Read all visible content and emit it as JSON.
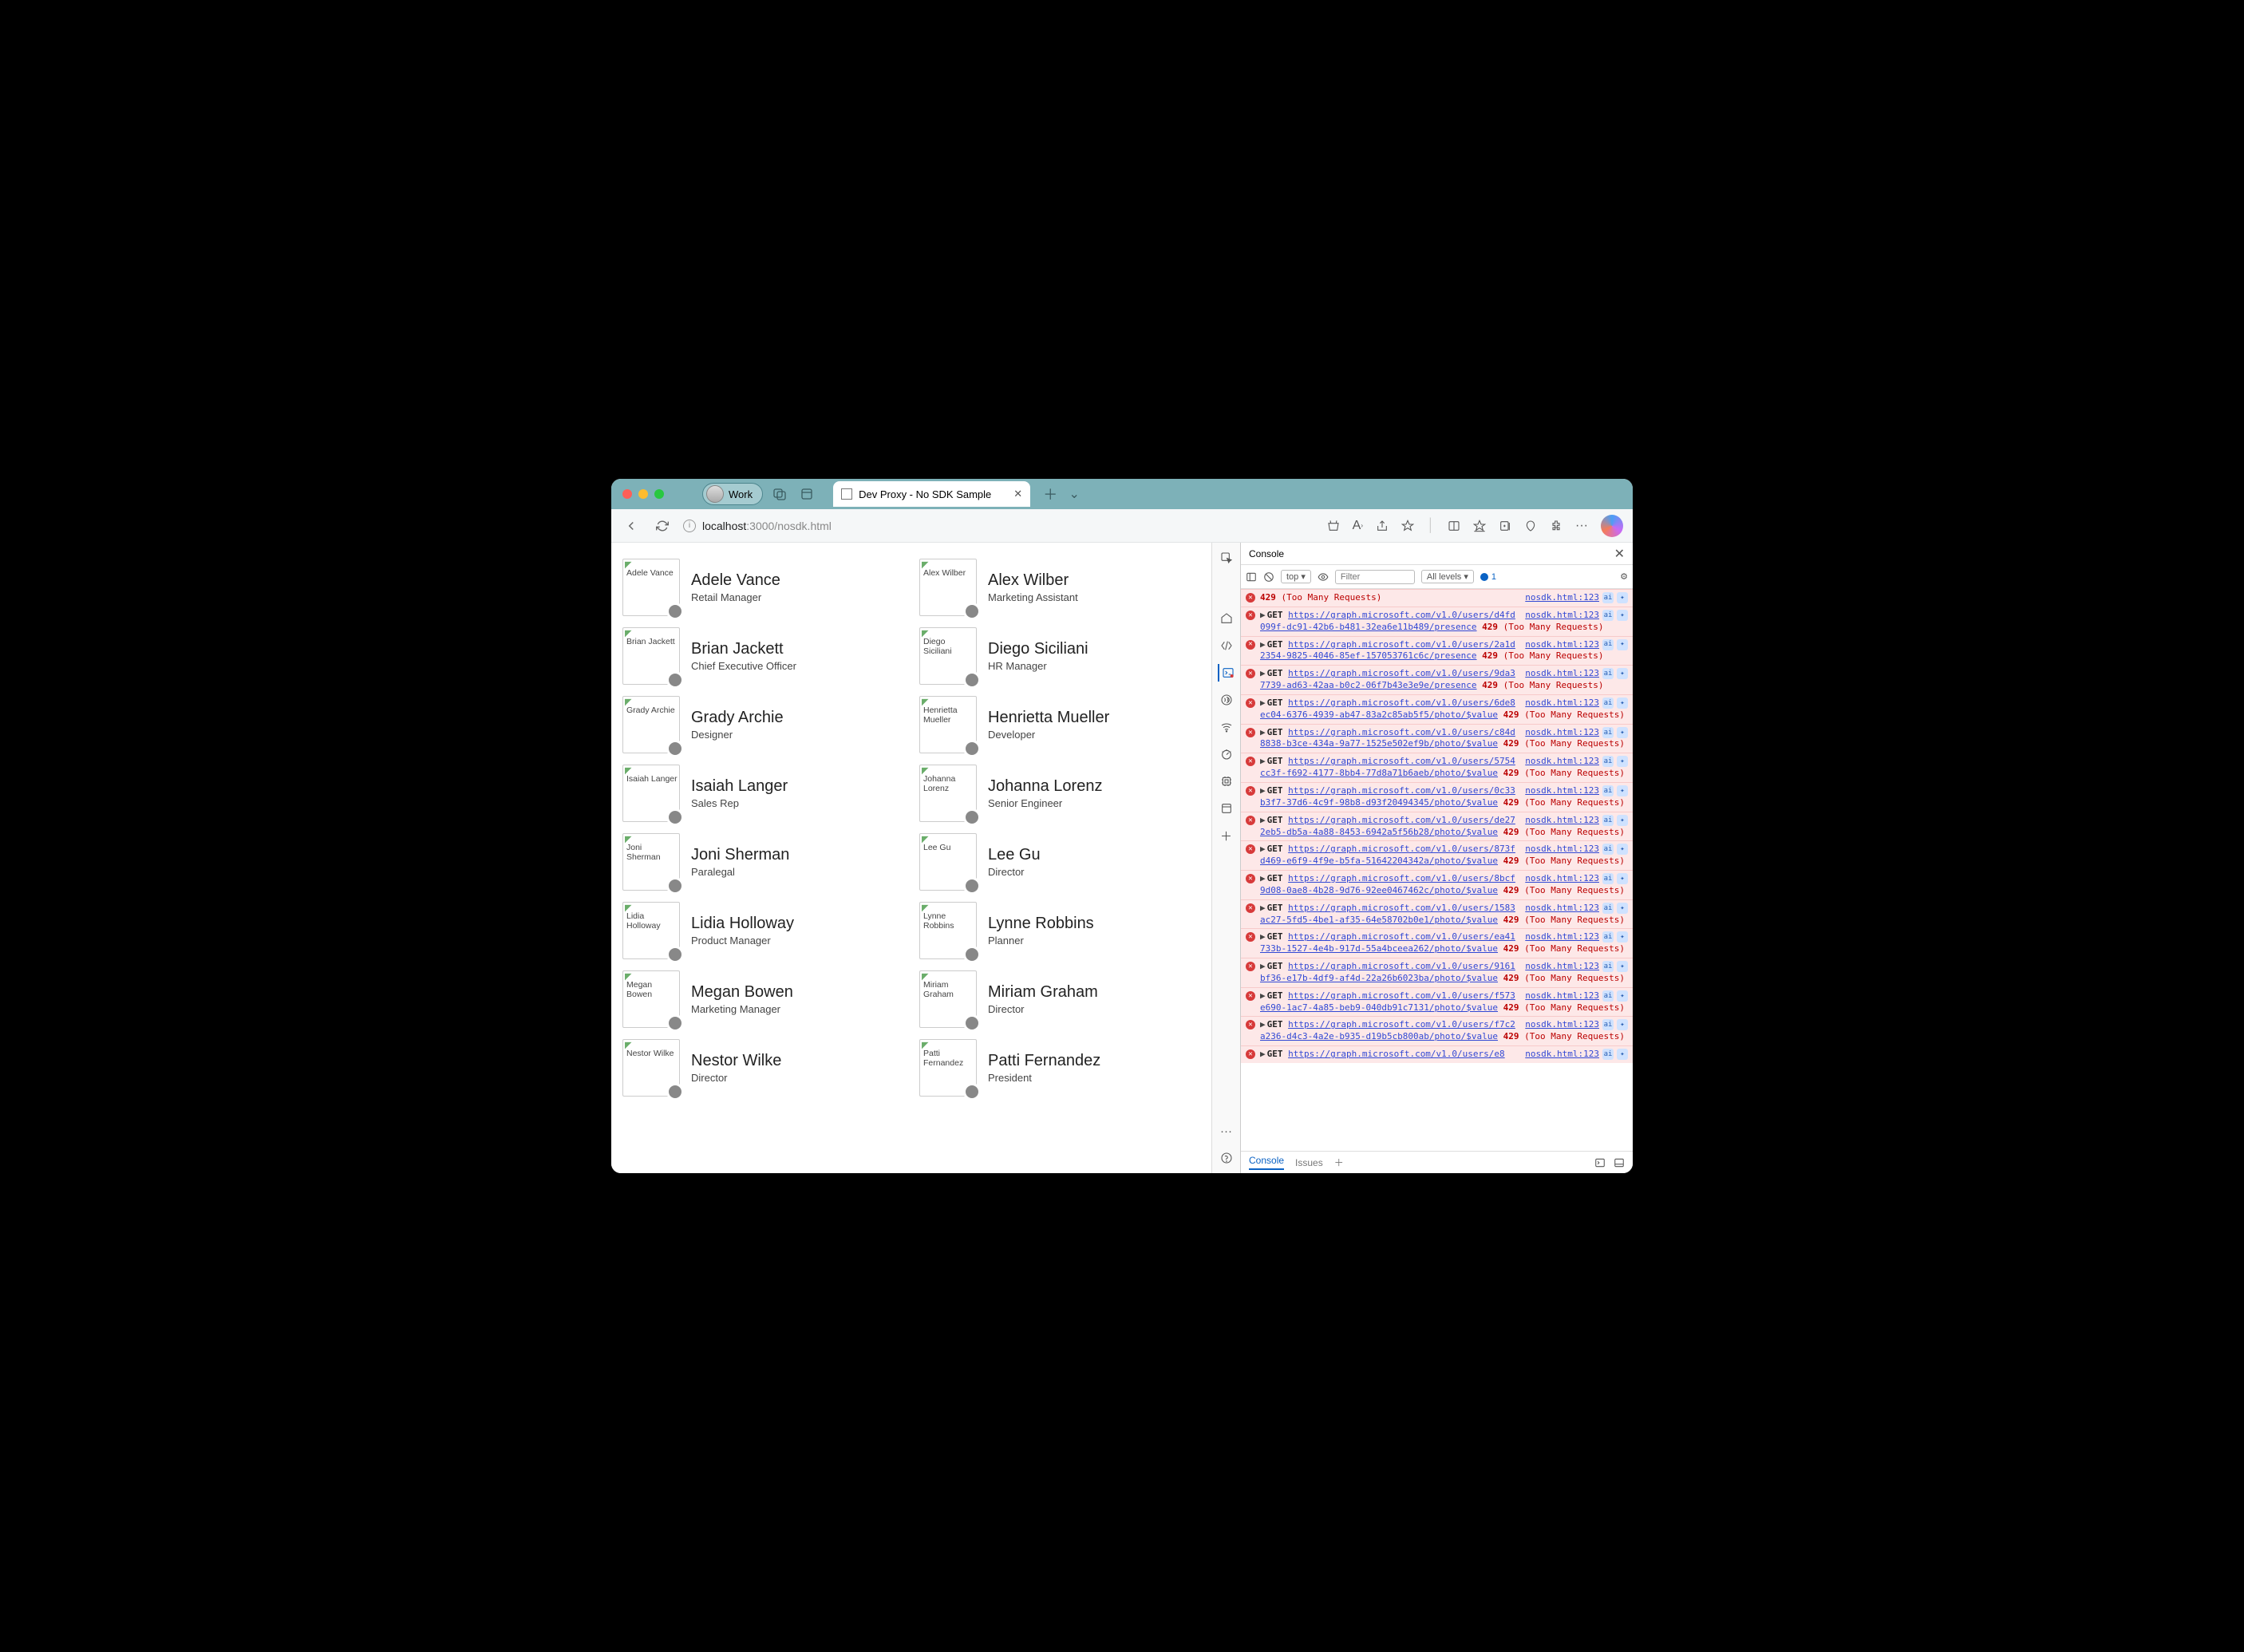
{
  "profile": {
    "label": "Work"
  },
  "tab": {
    "title": "Dev Proxy - No SDK Sample"
  },
  "url": {
    "info_icon": "i",
    "host": "localhost",
    "rest": ":3000/nosdk.html"
  },
  "people": [
    {
      "name": "Adele Vance",
      "title": "Retail Manager",
      "alt": "Adele Vance"
    },
    {
      "name": "Alex Wilber",
      "title": "Marketing Assistant",
      "alt": "Alex Wilber"
    },
    {
      "name": "Brian Jackett",
      "title": "Chief Executive Officer",
      "alt": "Brian Jackett"
    },
    {
      "name": "Diego Siciliani",
      "title": "HR Manager",
      "alt": "Diego Siciliani"
    },
    {
      "name": "Grady Archie",
      "title": "Designer",
      "alt": "Grady Archie"
    },
    {
      "name": "Henrietta Mueller",
      "title": "Developer",
      "alt": "Henrietta Mueller"
    },
    {
      "name": "Isaiah Langer",
      "title": "Sales Rep",
      "alt": "Isaiah Langer"
    },
    {
      "name": "Johanna Lorenz",
      "title": "Senior Engineer",
      "alt": "Johanna Lorenz"
    },
    {
      "name": "Joni Sherman",
      "title": "Paralegal",
      "alt": "Joni Sherman"
    },
    {
      "name": "Lee Gu",
      "title": "Director",
      "alt": "Lee Gu"
    },
    {
      "name": "Lidia Holloway",
      "title": "Product Manager",
      "alt": "Lidia Holloway"
    },
    {
      "name": "Lynne Robbins",
      "title": "Planner",
      "alt": "Lynne Robbins"
    },
    {
      "name": "Megan Bowen",
      "title": "Marketing Manager",
      "alt": "Megan Bowen"
    },
    {
      "name": "Miriam Graham",
      "title": "Director",
      "alt": "Miriam Graham"
    },
    {
      "name": "Nestor Wilke",
      "title": "Director",
      "alt": "Nestor Wilke"
    },
    {
      "name": "Patti Fernandez",
      "title": "President",
      "alt": "Patti Fernandez"
    }
  ],
  "devtools": {
    "title": "Console",
    "toolbar": {
      "context": "top",
      "filter_placeholder": "Filter",
      "levels": "All levels",
      "issue_count": "1"
    },
    "footer": {
      "console": "Console",
      "issues": "Issues"
    },
    "logs": [
      {
        "partial_top": true,
        "status": "429",
        "msg": "(Too Many Requests)",
        "src": "nosdk.html:123"
      },
      {
        "method": "GET",
        "url": "https://graph.microsoft.com/v1.0/users/d4fd099f-dc91-42b6-b481-32ea6e11b489/presence",
        "status": "429",
        "msg": "(Too Many Requests)",
        "src": "nosdk.html:123"
      },
      {
        "method": "GET",
        "url": "https://graph.microsoft.com/v1.0/users/2a1d2354-9825-4046-85ef-157053761c6c/presence",
        "status": "429",
        "msg": "(Too Many Requests)",
        "src": "nosdk.html:123"
      },
      {
        "method": "GET",
        "url": "https://graph.microsoft.com/v1.0/users/9da37739-ad63-42aa-b0c2-06f7b43e3e9e/presence",
        "status": "429",
        "msg": "(Too Many Requests)",
        "src": "nosdk.html:123"
      },
      {
        "method": "GET",
        "url": "https://graph.microsoft.com/v1.0/users/6de8ec04-6376-4939-ab47-83a2c85ab5f5/photo/$value",
        "status": "429",
        "msg": "(Too Many Requests)",
        "src": "nosdk.html:123"
      },
      {
        "method": "GET",
        "url": "https://graph.microsoft.com/v1.0/users/c84d8838-b3ce-434a-9a77-1525e502ef9b/photo/$value",
        "status": "429",
        "msg": "(Too Many Requests)",
        "src": "nosdk.html:123"
      },
      {
        "method": "GET",
        "url": "https://graph.microsoft.com/v1.0/users/5754cc3f-f692-4177-8bb4-77d8a71b6aeb/photo/$value",
        "status": "429",
        "msg": "(Too Many Requests)",
        "src": "nosdk.html:123"
      },
      {
        "method": "GET",
        "url": "https://graph.microsoft.com/v1.0/users/0c33b3f7-37d6-4c9f-98b8-d93f20494345/photo/$value",
        "status": "429",
        "msg": "(Too Many Requests)",
        "src": "nosdk.html:123"
      },
      {
        "method": "GET",
        "url": "https://graph.microsoft.com/v1.0/users/de272eb5-db5a-4a88-8453-6942a5f56b28/photo/$value",
        "status": "429",
        "msg": "(Too Many Requests)",
        "src": "nosdk.html:123"
      },
      {
        "method": "GET",
        "url": "https://graph.microsoft.com/v1.0/users/873fd469-e6f9-4f9e-b5fa-51642204342a/photo/$value",
        "status": "429",
        "msg": "(Too Many Requests)",
        "src": "nosdk.html:123"
      },
      {
        "method": "GET",
        "url": "https://graph.microsoft.com/v1.0/users/8bcf9d08-0ae8-4b28-9d76-92ee0467462c/photo/$value",
        "status": "429",
        "msg": "(Too Many Requests)",
        "src": "nosdk.html:123"
      },
      {
        "method": "GET",
        "url": "https://graph.microsoft.com/v1.0/users/1583ac27-5fd5-4be1-af35-64e58702b0e1/photo/$value",
        "status": "429",
        "msg": "(Too Many Requests)",
        "src": "nosdk.html:123"
      },
      {
        "method": "GET",
        "url": "https://graph.microsoft.com/v1.0/users/ea41733b-1527-4e4b-917d-55a4bceea262/photo/$value",
        "status": "429",
        "msg": "(Too Many Requests)",
        "src": "nosdk.html:123"
      },
      {
        "method": "GET",
        "url": "https://graph.microsoft.com/v1.0/users/9161bf36-e17b-4df9-af4d-22a26b6023ba/photo/$value",
        "status": "429",
        "msg": "(Too Many Requests)",
        "src": "nosdk.html:123"
      },
      {
        "method": "GET",
        "url": "https://graph.microsoft.com/v1.0/users/f573e690-1ac7-4a85-beb9-040db91c7131/photo/$value",
        "status": "429",
        "msg": "(Too Many Requests)",
        "src": "nosdk.html:123"
      },
      {
        "method": "GET",
        "url": "https://graph.microsoft.com/v1.0/users/f7c2a236-d4c3-4a2e-b935-d19b5cb800ab/photo/$value",
        "status": "429",
        "msg": "(Too Many Requests)",
        "src": "nosdk.html:123"
      },
      {
        "method": "GET",
        "url": "https://graph.microsoft.com/v1.0/users/e8",
        "status": "",
        "msg": "",
        "src": "nosdk.html:123",
        "partial_bottom": true
      }
    ]
  }
}
